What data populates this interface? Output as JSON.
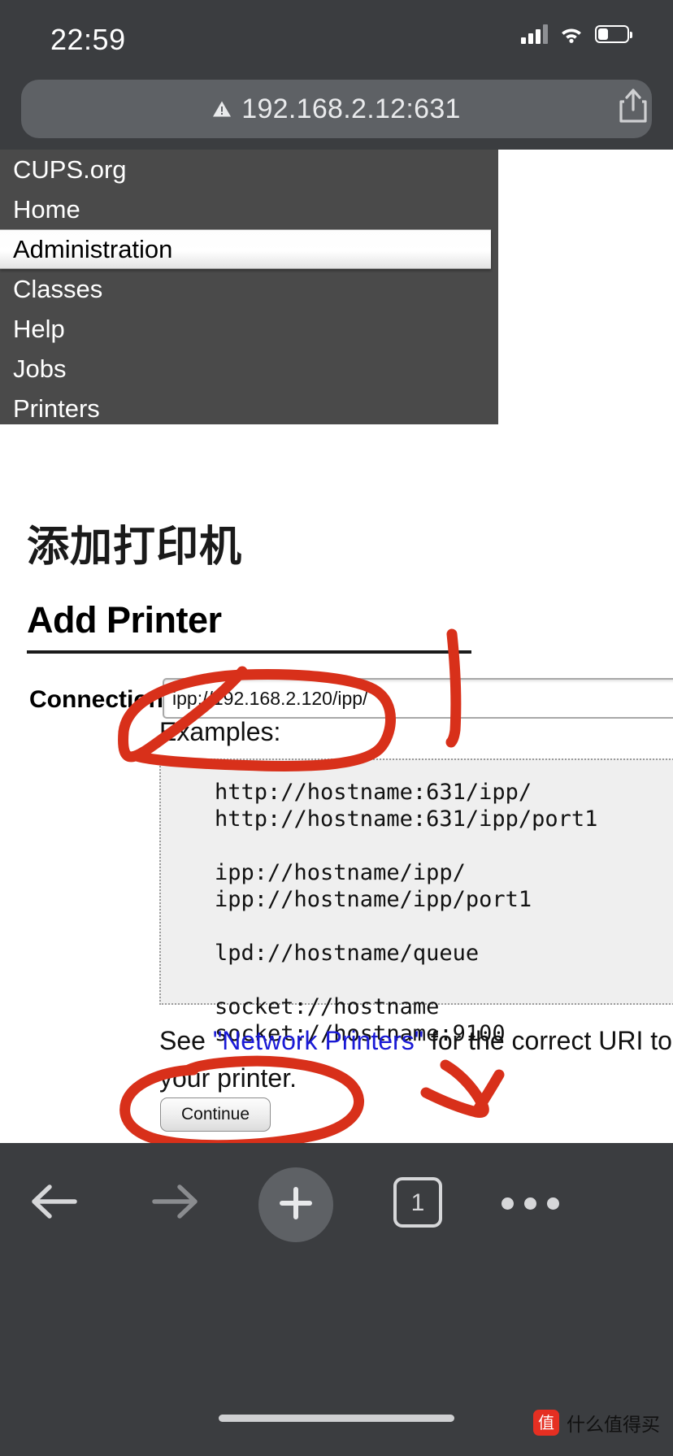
{
  "status_bar": {
    "time": "22:59",
    "signal_icon": "cellular-bars-icon",
    "wifi_icon": "wifi-icon",
    "battery_icon": "battery-icon"
  },
  "browser": {
    "url": "192.168.2.12:631",
    "warning_icon": "insecure-warning-triangle-icon",
    "share_icon": "share-icon",
    "toolbar": {
      "back_icon": "back-arrow-icon",
      "forward_icon": "forward-arrow-icon",
      "add_icon": "plus-icon",
      "tabs_label": "1",
      "more_icon": "more-dots-icon"
    }
  },
  "nav": {
    "items": [
      {
        "label": "CUPS.org",
        "active": false
      },
      {
        "label": "Home",
        "active": false
      },
      {
        "label": "Administration",
        "active": true
      },
      {
        "label": "Classes",
        "active": false
      },
      {
        "label": "Help",
        "active": false
      },
      {
        "label": "Jobs",
        "active": false
      },
      {
        "label": "Printers",
        "active": false
      }
    ]
  },
  "page": {
    "heading_cn": "添加打印机",
    "heading_en": "Add Printer",
    "connection_label": "Connection:",
    "connection_value": "ipp://192.168.2.120/ipp/",
    "connection_placeholder": "",
    "examples_label": "Examples:",
    "examples_text": "http://hostname:631/ipp/\nhttp://hostname:631/ipp/port1\n\nipp://hostname/ipp/\nipp://hostname/ipp/port1\n\nlpd://hostname/queue\n\nsocket://hostname\nsocket://hostname:9100",
    "see_note_prefix": "See ",
    "see_note_link": "\"Network Printers\"",
    "see_note_suffix": " for the correct URI to u",
    "see_note_line2": "your printer.",
    "continue_label": "Continue"
  },
  "annotations": {
    "color": "#d8301a",
    "marks": [
      "circle-around-connection-field",
      "vertical-stroke-right-of-field",
      "circle-around-continue-button",
      "check-mark-right-of-continue"
    ]
  },
  "watermark": {
    "badge": "值",
    "text": "什么值得买"
  }
}
